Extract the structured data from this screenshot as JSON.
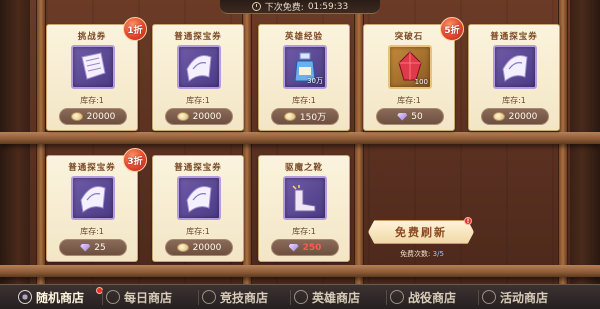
{
  "timer": {
    "label": "下次免费:",
    "value": "01:59:33"
  },
  "cards": [
    {
      "title": "挑战券",
      "stock": "库存:1",
      "price": "20000",
      "currency": "coin",
      "discount": "1折",
      "icon": "challenge-ticket-icon",
      "qty": ""
    },
    {
      "title": "普通探宝券",
      "stock": "库存:1",
      "price": "20000",
      "currency": "coin",
      "discount": "",
      "icon": "treasure-ticket-icon",
      "qty": ""
    },
    {
      "title": "英雄经验",
      "stock": "库存:1",
      "price": "150万",
      "currency": "coin",
      "discount": "",
      "icon": "hero-exp-potion-icon",
      "qty": "30万"
    },
    {
      "title": "突破石",
      "stock": "库存:1",
      "price": "50",
      "currency": "gem",
      "discount": "5折",
      "icon": "breakthrough-stone-icon",
      "qty": "100"
    },
    {
      "title": "普通探宝券",
      "stock": "库存:1",
      "price": "20000",
      "currency": "coin",
      "discount": "",
      "icon": "treasure-ticket-icon",
      "qty": ""
    },
    {
      "title": "普通探宝券",
      "stock": "库存:1",
      "price": "25",
      "currency": "gem",
      "discount": "3折",
      "icon": "treasure-ticket-icon",
      "qty": ""
    },
    {
      "title": "普通探宝券",
      "stock": "库存:1",
      "price": "20000",
      "currency": "coin",
      "discount": "",
      "icon": "treasure-ticket-icon",
      "qty": ""
    },
    {
      "title": "驱魔之靴",
      "stock": "库存:1",
      "price": "250",
      "currency": "gem",
      "discount": "",
      "icon": "exorcist-boots-icon",
      "qty": ""
    }
  ],
  "refresh": {
    "label": "免费刷新",
    "badge": "!",
    "count_label": "免费次数:",
    "count_value": "3/5"
  },
  "tabs": [
    {
      "label": "随机商店",
      "active": true,
      "badge": "!"
    },
    {
      "label": "每日商店",
      "active": false,
      "badge": ""
    },
    {
      "label": "竞技商店",
      "active": false,
      "badge": ""
    },
    {
      "label": "英雄商店",
      "active": false,
      "badge": ""
    },
    {
      "label": "战役商店",
      "active": false,
      "badge": ""
    },
    {
      "label": "活动商店",
      "active": false,
      "badge": ""
    }
  ],
  "colors": {
    "discount": "#e0432a",
    "gem_price": "#ff5a4a",
    "free_count": "#8ac8ff",
    "refresh_text": "#8a4a22"
  }
}
